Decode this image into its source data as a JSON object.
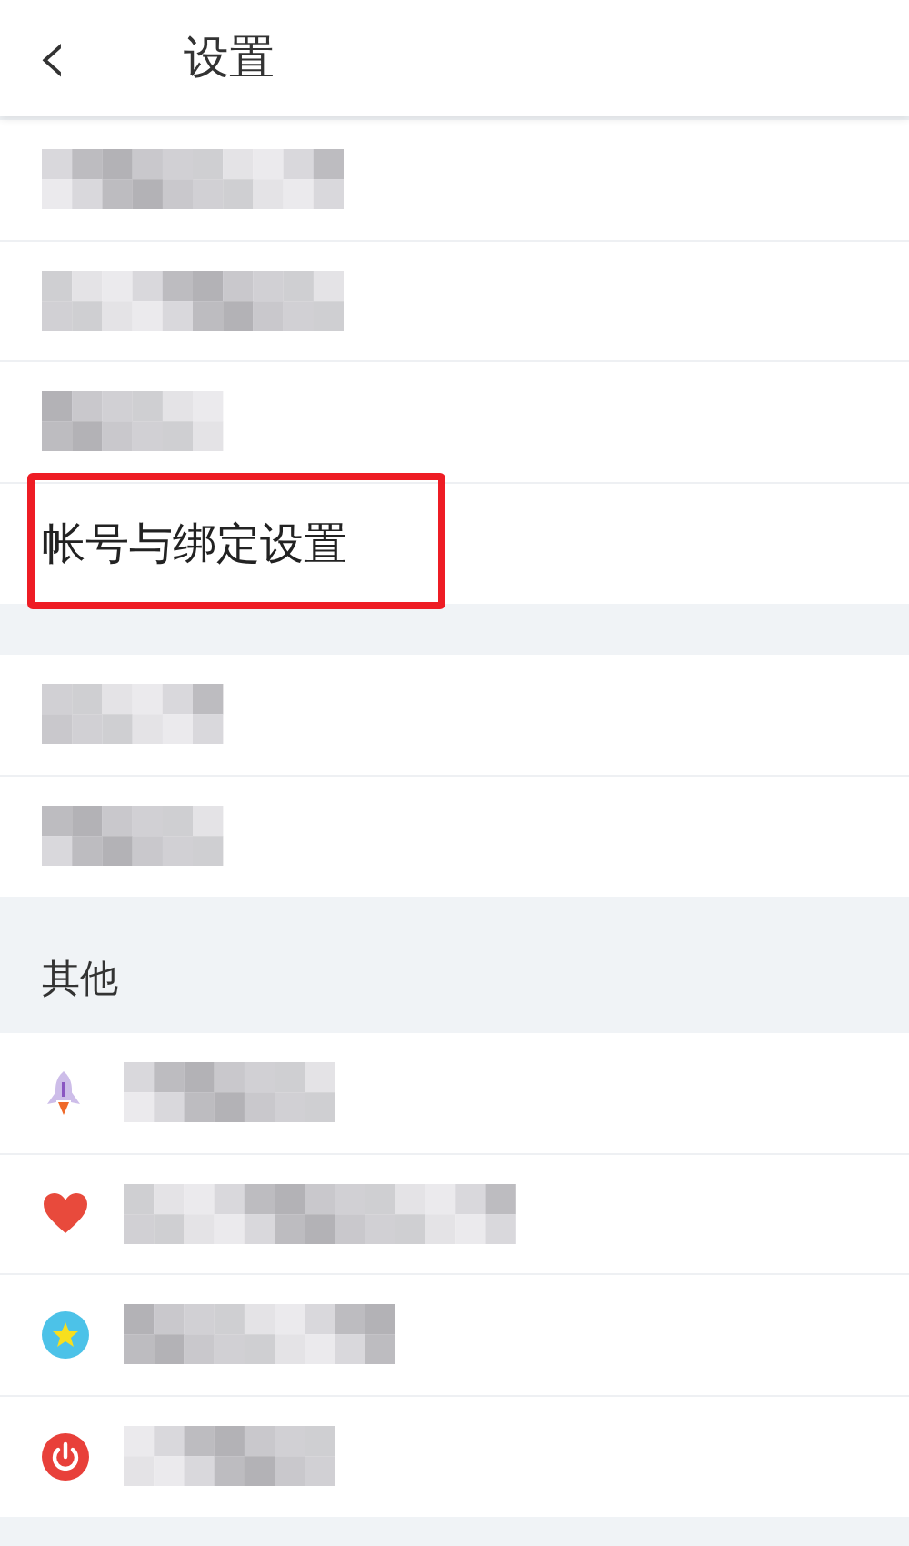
{
  "header": {
    "back_icon": "‹",
    "title": "设置"
  },
  "sections": [
    {
      "items": [
        {
          "kind": "redacted",
          "highlighted": false
        },
        {
          "kind": "redacted",
          "highlighted": false
        },
        {
          "kind": "redacted",
          "highlighted": false
        },
        {
          "kind": "text",
          "label": "帐号与绑定设置",
          "highlighted": true
        }
      ]
    },
    {
      "items": [
        {
          "kind": "redacted",
          "highlighted": false
        },
        {
          "kind": "redacted",
          "highlighted": false
        }
      ]
    },
    {
      "title": "其他",
      "kind": "with_icons",
      "items": [
        {
          "kind": "redacted",
          "highlighted": false
        },
        {
          "kind": "redacted",
          "highlighted": false
        },
        {
          "kind": "redacted",
          "highlighted": false
        },
        {
          "kind": "redacted",
          "highlighted": false
        }
      ]
    }
  ]
}
